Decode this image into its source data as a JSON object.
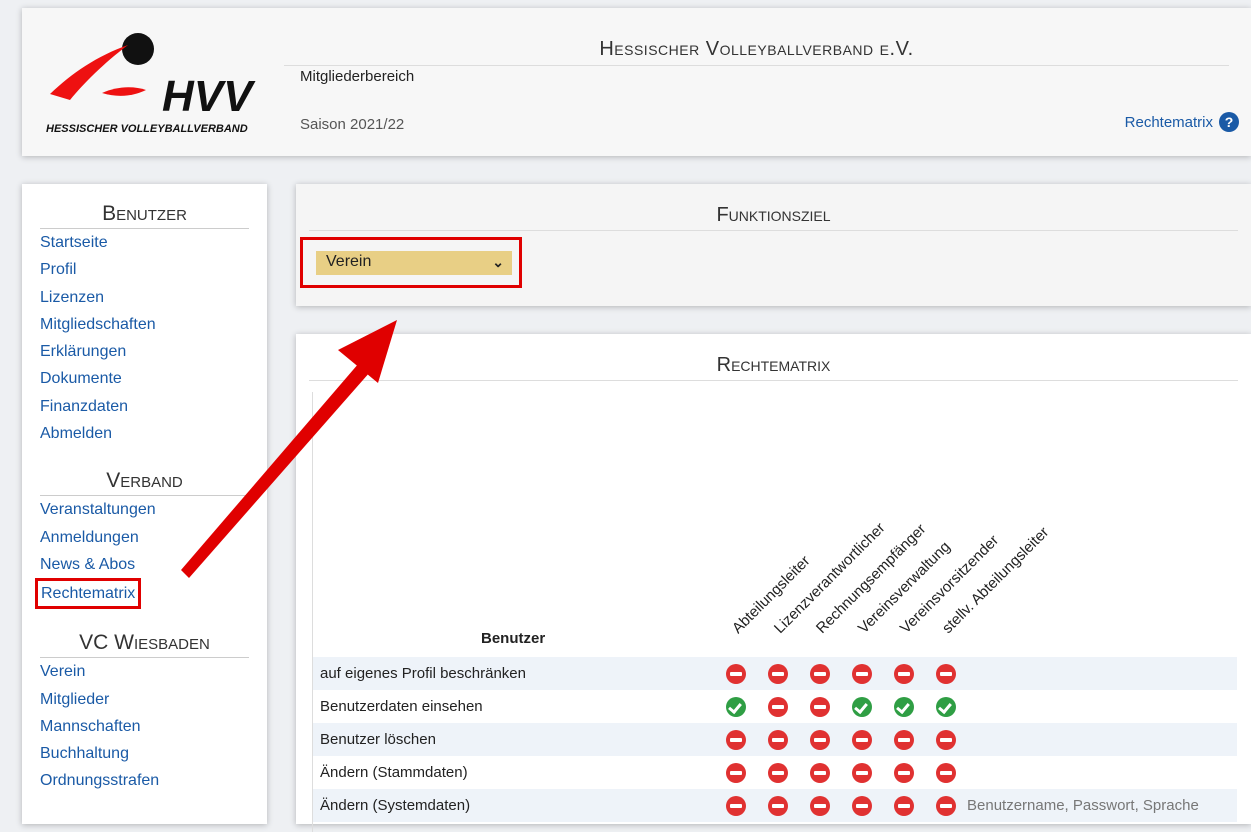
{
  "header": {
    "org_title": "Hessischer Volleyballverband e.V.",
    "subtitle": "Mitgliederbereich",
    "season": "Saison 2021/22",
    "help_link": "Rechtematrix",
    "help_icon": "?",
    "logo": {
      "wordmark": "HVV",
      "tagline": "HESSISCHER VOLLEYBALLVERBAND"
    }
  },
  "sidebar": {
    "sections": [
      {
        "title": "Benutzer",
        "items": [
          "Startseite",
          "Profil",
          "Lizenzen",
          "Mitgliedschaften",
          "Erklärungen",
          "Dokumente",
          "Finanzdaten",
          "Abmelden"
        ]
      },
      {
        "title": "Verband",
        "items": [
          "Veranstaltungen",
          "Anmeldungen",
          "News & Abos",
          "Rechtematrix"
        ]
      },
      {
        "title": "VC Wiesbaden",
        "items": [
          "Verein",
          "Mitglieder",
          "Mannschaften",
          "Buchhaltung",
          "Ordnungsstrafen"
        ]
      }
    ]
  },
  "funktionsziel": {
    "title": "Funktionsziel",
    "select_value": "Verein"
  },
  "rechtematrix": {
    "title": "Rechtematrix",
    "row_header": "Benutzer",
    "columns": [
      "Abteilungsleiter",
      "Lizenzverantwortlicher",
      "Rechnungsempfänger",
      "Vereinsverwaltung",
      "Vereinsvorsitzender",
      "stellv. Abteilungsleiter"
    ],
    "rows": [
      {
        "label": "auf eigenes Profil beschränken",
        "values": [
          "no",
          "no",
          "no",
          "no",
          "no",
          "no"
        ],
        "note": ""
      },
      {
        "label": "Benutzerdaten einsehen",
        "values": [
          "yes",
          "no",
          "no",
          "yes",
          "yes",
          "yes"
        ],
        "note": ""
      },
      {
        "label": "Benutzer löschen",
        "values": [
          "no",
          "no",
          "no",
          "no",
          "no",
          "no"
        ],
        "note": ""
      },
      {
        "label": "Ändern (Stammdaten)",
        "values": [
          "no",
          "no",
          "no",
          "no",
          "no",
          "no"
        ],
        "note": ""
      },
      {
        "label": "Ändern (Systemdaten)",
        "values": [
          "no",
          "no",
          "no",
          "no",
          "no",
          "no"
        ],
        "note": "Benutzername, Passwort, Sprache"
      }
    ]
  },
  "colors": {
    "link": "#1a5aa6",
    "select_bg": "#e8cf85",
    "highlight": "#e00000",
    "yes": "#2f9e44",
    "no": "#e03131"
  }
}
